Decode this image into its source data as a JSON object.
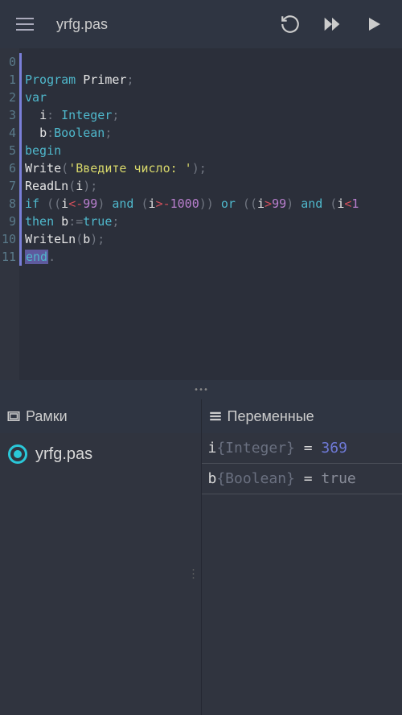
{
  "header": {
    "title": "yrfg.pas"
  },
  "gutter": [
    "0",
    "1",
    "2",
    "3",
    "4",
    "5",
    "6",
    "7",
    "8",
    "9",
    "10",
    "11"
  ],
  "code": {
    "l0": {
      "kw": "Program",
      "id": "Primer",
      "p": ";"
    },
    "l1": {
      "kw": "var"
    },
    "l2": {
      "id": "i",
      "p1": ":",
      "ty": "Integer",
      "p2": ";"
    },
    "l3": {
      "id": "b",
      "p1": ":",
      "ty": "Boolean",
      "p2": ";"
    },
    "l4": {
      "kw": "begin"
    },
    "l5": {
      "fn": "Write",
      "p1": "(",
      "str": "'Введите число: '",
      "p2": ");"
    },
    "l6": {
      "fn": "ReadLn",
      "p1": "(",
      "id": "i",
      "p2": ");"
    },
    "l7": {
      "kw1": "if",
      "p1": " ((",
      "id1": "i",
      "op1": "<-",
      "n1": "99",
      "p2": ") ",
      "kw2": "and",
      "p3": " (",
      "id2": "i",
      "op2": ">-",
      "n2": "1000",
      "p4": ")) ",
      "kw3": "or",
      "p5": " ((",
      "id3": "i",
      "op3": ">",
      "n3": "99",
      "p6": ") ",
      "kw4": "and",
      "p7": " (",
      "id4": "i",
      "op4": "<",
      "n4": "1"
    },
    "l8": {
      "kw1": "then",
      "id": "b",
      "p1": ":=",
      "v": "true",
      "p2": ";"
    },
    "l9": {
      "fn": "WriteLn",
      "p1": "(",
      "id": "b",
      "p2": ");"
    },
    "l10": {
      "kw": "end",
      "p": "."
    }
  },
  "panels": {
    "frames": {
      "title": "Рамки",
      "items": [
        {
          "label": "yrfg.pas"
        }
      ]
    },
    "vars": {
      "title": "Переменные",
      "items": [
        {
          "name": "i",
          "type": "{Integer}",
          "eq": " = ",
          "value": "369",
          "valueClass": "num"
        },
        {
          "name": "b",
          "type": "{Boolean}",
          "eq": " = ",
          "value": "true",
          "valueClass": "bool"
        }
      ]
    }
  }
}
